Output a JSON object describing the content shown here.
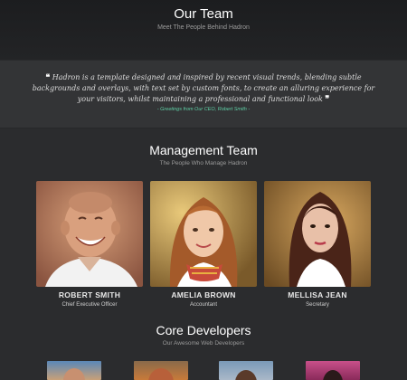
{
  "header": {
    "title": "Our Team",
    "subtitle": "Meet The People Behind Hadron"
  },
  "quote": {
    "open_mark": "❝",
    "close_mark": "❞",
    "text": "Hadron is a template designed and inspired by recent visual trends, blending subtle backgrounds and overlays, with text set by custom fonts, to create an alluring experience for your visitors, whilst maintaining a professional and functional look",
    "greeting": "- Greetings from Our CEO, Robert Smith -"
  },
  "management": {
    "title": "Management Team",
    "subtitle": "The People Who Manage Hadron",
    "members": [
      {
        "name": "ROBERT SMITH",
        "role": "Chief Executive Officer"
      },
      {
        "name": "AMELIA BROWN",
        "role": "Accountant"
      },
      {
        "name": "MELLISA JEAN",
        "role": "Secretary"
      }
    ]
  },
  "developers": {
    "title": "Core Developers",
    "subtitle": "Our Awesome Web Developers"
  },
  "colors": {
    "background": "#2b2c2e",
    "header": "#1c1d1f",
    "quote_band": "#333436",
    "accent_green": "#5fd0a6"
  }
}
